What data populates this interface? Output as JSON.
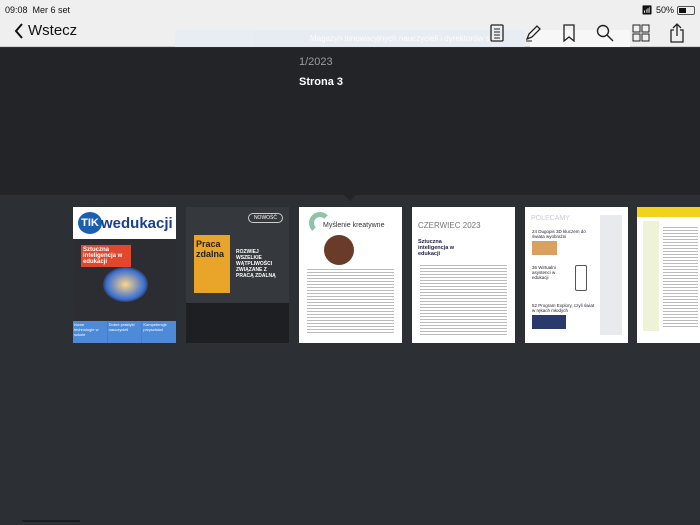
{
  "status": {
    "time": "09:08",
    "date": "Mer 6 set",
    "battery": "50%"
  },
  "nav": {
    "back_label": "Wstecz",
    "ghost_text": "Magazyn innowacyjnych nauczycieli i dyrektorów szkół",
    "tools": [
      "table-of-contents-icon",
      "annotate-pencil-icon",
      "bookmark-icon",
      "search-icon",
      "page-grid-icon",
      "share-icon"
    ]
  },
  "header": {
    "issue": "1/2023",
    "page": "Strona 3"
  },
  "thumbnails": [
    {
      "title": "TIK w edukacji",
      "tik": "TIK",
      "brand": "wedukacji",
      "headline": "Sztuczna inteligencja w edukacji",
      "boxes": [
        "Nowe technologie w szkole",
        "Dobre praktyki nauczycieli",
        "Kompetencje przyszłości"
      ]
    },
    {
      "badge": "NOWOŚĆ",
      "book": "Praca zdalna",
      "text": "ROZWIEJ WSZELKIE WĄTPLIWOŚCI ZWIĄZANE Z PRACĄ ZDALNĄ"
    },
    {
      "title": "Myślenie kreatywne"
    },
    {
      "heading": "CZERWIEC 2023",
      "subheading": "Sztuczna inteligencja w edukacji"
    },
    {
      "heading": "POLECAMY",
      "items": [
        "24 Dugopis 3D kluczem do świata wyobraźni",
        "36 Wirtualni asystenci w edukacji",
        "52 Program Explory, czyli świat w rękach młodych"
      ]
    },
    {}
  ]
}
